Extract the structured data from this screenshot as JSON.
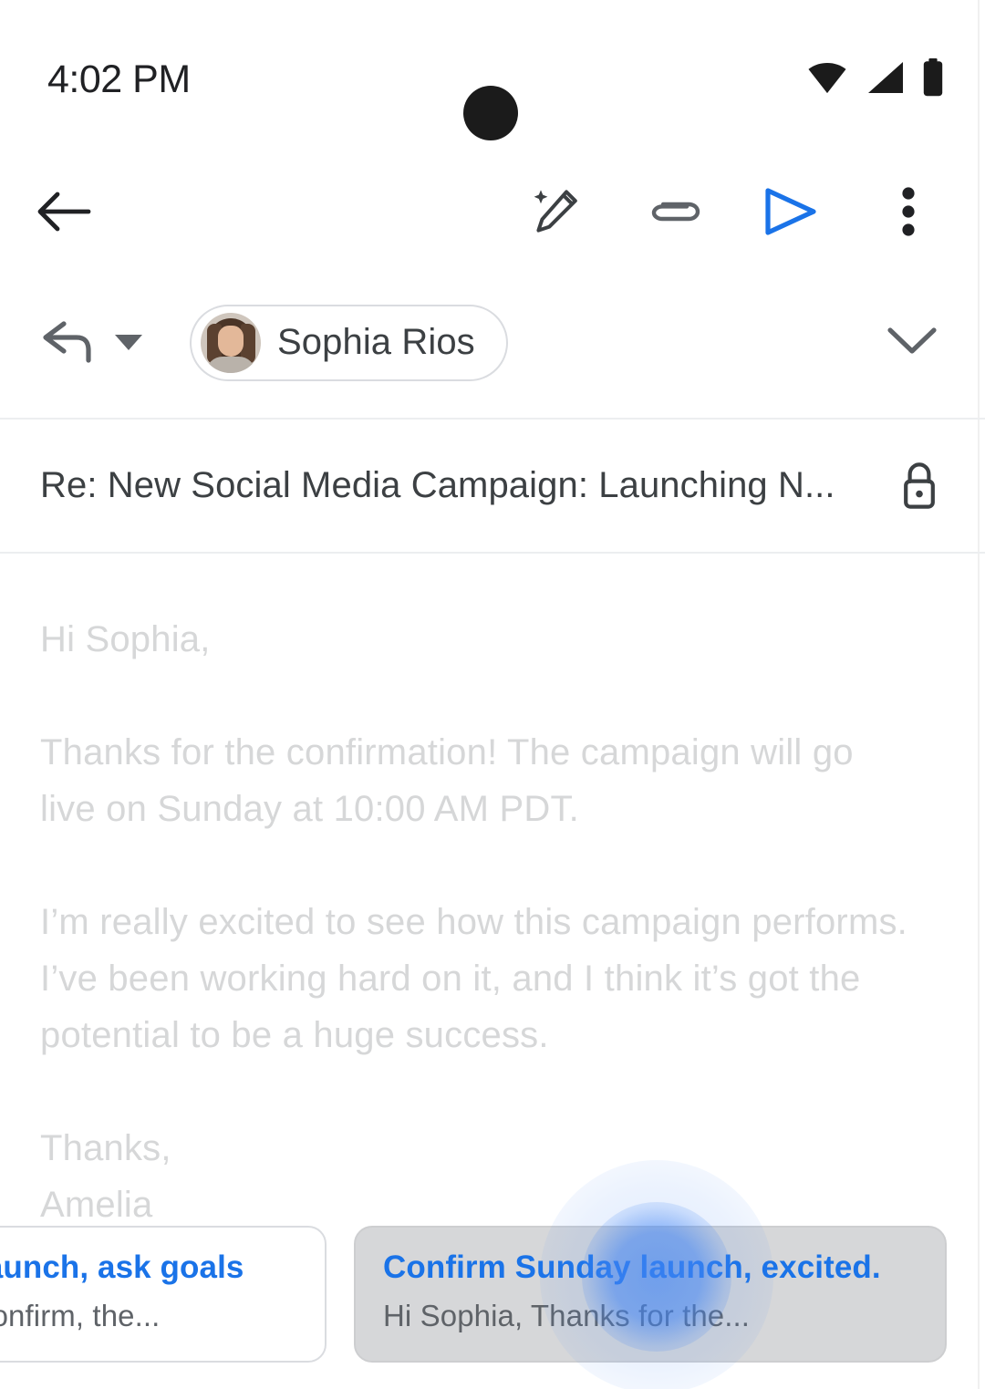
{
  "status_bar": {
    "time": "4:02 PM",
    "icons": [
      "wifi-icon",
      "cellular-signal-icon",
      "battery-icon"
    ],
    "camera_cutout": "camera-punch-hole"
  },
  "toolbar": {
    "back_label": "back-arrow-icon",
    "actions": [
      {
        "name": "ai-write-icon",
        "label": "Help me write"
      },
      {
        "name": "attach-icon",
        "label": "Attach file"
      },
      {
        "name": "send-icon",
        "label": "Send",
        "color": "#1a73e8"
      },
      {
        "name": "more-options-icon",
        "label": "More options"
      }
    ]
  },
  "compose": {
    "reply_mode_label": "reply-arrow-icon",
    "recipient": {
      "name": "Sophia Rios",
      "avatar": "sophia-rios-avatar"
    },
    "expand_label": "chevron-down-icon",
    "subject": "Re: New Social Media Campaign: Launching N...",
    "confidential_icon": "lock-icon",
    "body": [
      "Hi Sophia,",
      "Thanks for the confirmation! The campaign will go live on Sunday at 10:00 AM PDT.",
      "I’m really excited to see how this campaign performs. I’ve been working hard on it, and I think it’s got the potential to be a huge success.",
      "Thanks,\nAmelia"
    ]
  },
  "suggestions": {
    "cards": [
      {
        "title": "launch, ask goals",
        "subtitle": "confirm, the...",
        "state": "partially-offscreen"
      },
      {
        "title": "Confirm Sunday launch, excited.",
        "subtitle": "Hi Sophia, Thanks for the...",
        "state": "pressed"
      }
    ]
  },
  "colors": {
    "accent_blue": "#1a73e8",
    "ripple_blue": "#4285f4",
    "body_text": "#d6d7d8",
    "primary_text": "#3c4043",
    "secondary_text": "#5f6368",
    "divider": "#eceef0",
    "pressed_card_bg": "#d6d7d9"
  }
}
